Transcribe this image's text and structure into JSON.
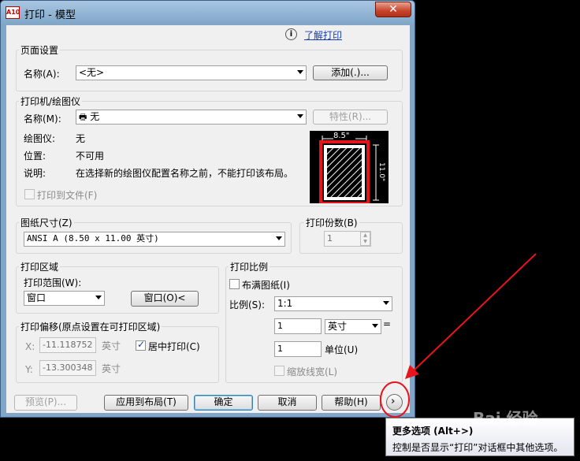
{
  "window": {
    "title": "打印 - 模型",
    "app_icon": "A10",
    "close_glyph": "✕"
  },
  "help_link": {
    "icon": "i",
    "label": "了解打印"
  },
  "page_setup": {
    "group": "页面设置",
    "name_label": "名称(A):",
    "name_value": "<无>",
    "add_button": "添加(.)..."
  },
  "printer": {
    "group": "打印机/绘图仪",
    "name_label": "名称(M):",
    "name_value": "无",
    "properties_button": "特性(R)...",
    "plotter_label": "绘图仪:",
    "plotter_value": "无",
    "location_label": "位置:",
    "location_value": "不可用",
    "description_label": "说明:",
    "description_value": "在选择新的绘图仪配置名称之前，不能打印该布局。",
    "print_to_file": "打印到文件(F)",
    "preview_width": "8.5\"",
    "preview_height": "11.0\""
  },
  "paper_size": {
    "group": "图纸尺寸(Z)",
    "value": "ANSI A (8.50 x 11.00 英寸)"
  },
  "copies": {
    "group": "打印份数(B)",
    "value": "1"
  },
  "plot_area": {
    "group": "打印区域",
    "range_label": "打印范围(W):",
    "range_value": "窗口",
    "window_button": "窗口(O)<"
  },
  "plot_offset": {
    "group": "打印偏移(原点设置在可打印区域)",
    "x_label": "X:",
    "x_value": "-11.118752",
    "x_unit": "英寸",
    "y_label": "Y:",
    "y_value": "-13.300348",
    "y_unit": "英寸",
    "center_label": "居中打印(C)"
  },
  "plot_scale": {
    "group": "打印比例",
    "fit_label": "布满图纸(I)",
    "scale_label": "比例(S):",
    "scale_value": "1:1",
    "value1": "1",
    "unit1": "英寸",
    "equals": "=",
    "value2": "1",
    "unit2": "单位(U)",
    "lineweights_label": "缩放线宽(L)"
  },
  "buttons": {
    "preview": "预览(P)...",
    "apply_layout": "应用到布局(T)",
    "ok": "确定",
    "cancel": "取消",
    "help": "帮助(H)"
  },
  "tooltip": {
    "title": "更多选项 (Alt+>)",
    "body": "控制是否显示“打印”对话框中其他选项。"
  },
  "watermark": {
    "text": "Bai 经验"
  },
  "colors": {
    "annotation_red": "#e8141c",
    "accent_blue": "#1a3ea8"
  }
}
